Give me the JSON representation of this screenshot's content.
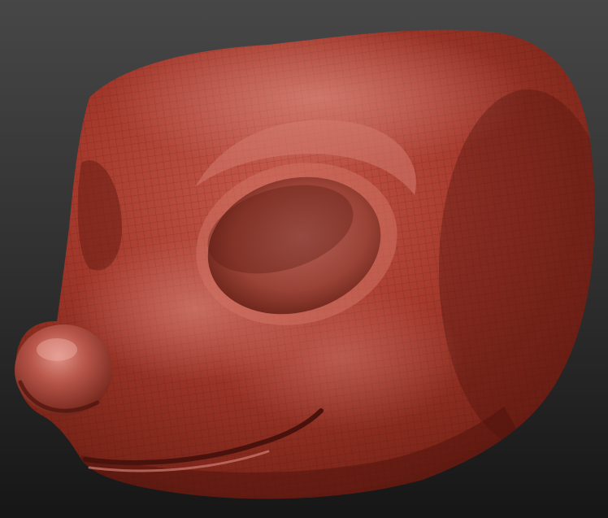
{
  "viewport": {
    "background_top": "#454545",
    "background_bottom": "#181818"
  },
  "model": {
    "subject": "sculpted-animal-head",
    "material_color": "#a8392c",
    "highlight_color": "#d9857a",
    "shadow_color": "#4a120c",
    "wireframe_visible": true,
    "wireframe_color": "#3a0d08"
  }
}
